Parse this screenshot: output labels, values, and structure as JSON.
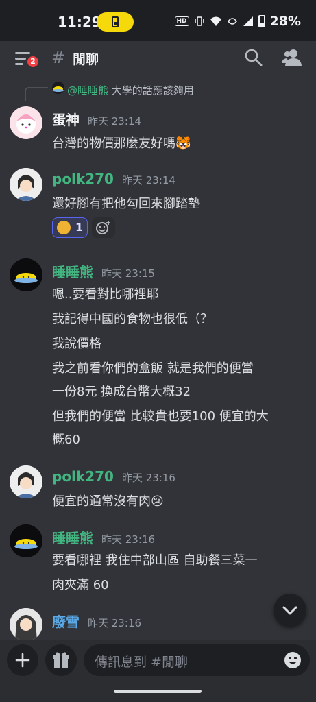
{
  "status_bar": {
    "time": "11:29",
    "battery_percent": "28%",
    "hd_label": "HD"
  },
  "header": {
    "channel_name": "閒聊",
    "hash": "#",
    "notification_badge": "2"
  },
  "messages": [
    {
      "author": "蛋神",
      "author_color": "#f2f3f5",
      "timestamp": "昨天 23:14",
      "reply": {
        "name": "@睡睡熊",
        "text": "大學的話應該夠用"
      },
      "lines": [
        "台灣的物價那麼友好嗎🐯"
      ]
    },
    {
      "author": "polk270",
      "author_color": "#43b581",
      "timestamp": "昨天 23:14",
      "lines": [
        "還好腳有把他勾回來腳踏墊"
      ],
      "reaction": {
        "emoji": "rofl",
        "count": "1"
      }
    },
    {
      "author": "睡睡熊",
      "author_color": "#43b581",
      "timestamp": "昨天 23:15",
      "lines": [
        "嗯..要看對比哪裡耶",
        "我記得中國的食物也很低（？",
        "我說價格",
        "我之前看你們的盒飯 就是我們的便當",
        "一份8元 換成台幣大概32",
        "但我們的便當 比較貴也要100 便宜的大",
        "概60"
      ]
    },
    {
      "author": "polk270",
      "author_color": "#43b581",
      "timestamp": "昨天 23:16",
      "lines": [
        "便宜的通常沒有肉😢"
      ]
    },
    {
      "author": "睡睡熊",
      "author_color": "#43b581",
      "timestamp": "昨天 23:16",
      "lines": [
        "要看哪裡 我住中部山區 自助餐三菜一",
        "肉夾滿 60"
      ]
    },
    {
      "author": "廢雪",
      "author_color": "#5aa9e6",
      "timestamp": "昨天 23:16",
      "lines": []
    }
  ],
  "composer": {
    "placeholder": "傳訊息到 #閒聊"
  }
}
